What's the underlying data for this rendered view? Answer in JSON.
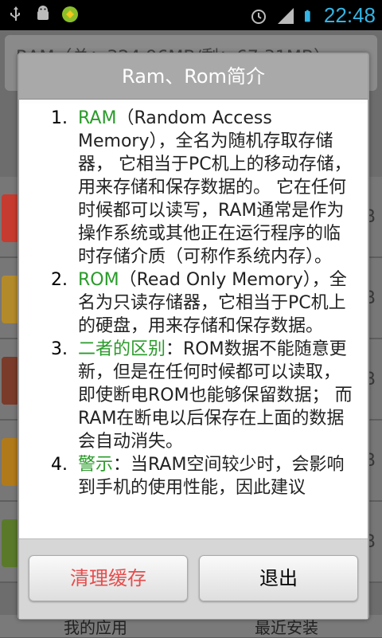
{
  "status_bar": {
    "time": "22:48",
    "icons": [
      "usb-icon",
      "android-debug-icon",
      "app-icon",
      "alarm-icon",
      "signal-icon",
      "battery-icon"
    ]
  },
  "background_app": {
    "header_text": "RAM（总：324.96MB/剩：67.31MB）",
    "row_size_suffix": "B",
    "tabs": [
      "我的应用",
      "最近安装"
    ]
  },
  "dialog": {
    "title": "Ram、Rom简介",
    "items": [
      {
        "num": "1.",
        "title": "RAM",
        "text": "（Random Access Memory），全名为随机存取存储器， 它相当于PC机上的移动存储，用来存储和保存数据的。 它在任何时候都可以读写，RAM通常是作为操作系统或其他正在运行程序的临时存储介质（可称作系统内存）。"
      },
      {
        "num": "2.",
        "title": "ROM",
        "text": "（Read Only Memory），全名为只读存储器，它相当于PC机上的硬盘，用来存储和保存数据。"
      },
      {
        "num": "3.",
        "title": "二者的区别",
        "text": "：ROM数据不能随意更新，但是在任何时候都可以读取，即使断电ROM也能够保留数据； 而RAM在断电以后保存在上面的数据会自动消失。"
      },
      {
        "num": "4.",
        "title": "警示",
        "text": "：当RAM空间较少时，会影响到手机的使用性能，因此建议"
      }
    ],
    "buttons": {
      "clear_label": "清理缓存",
      "exit_label": "退出"
    }
  },
  "colors": {
    "accent_green": "#2a9b2a",
    "clear_red": "#e54d4d",
    "time_blue": "#33b5e5"
  }
}
